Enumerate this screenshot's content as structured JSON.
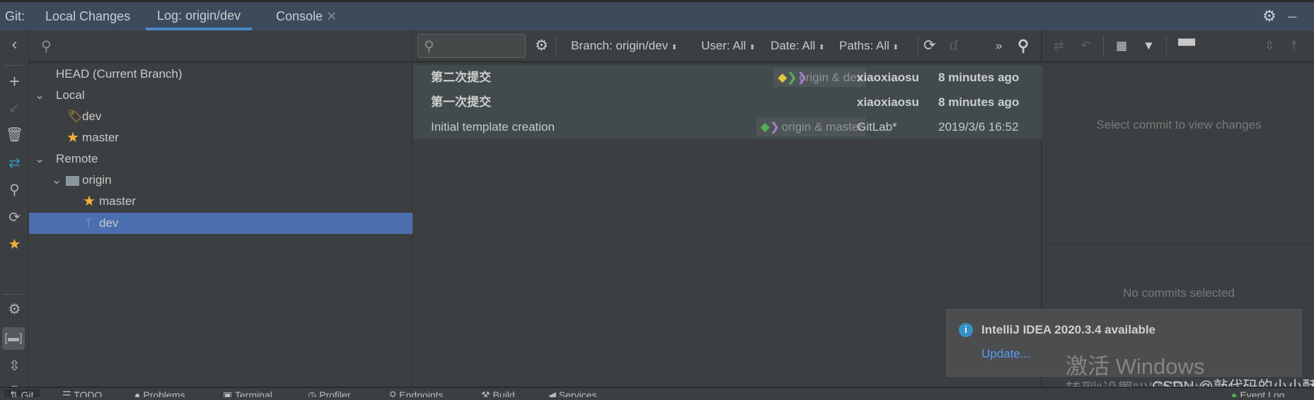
{
  "tabs": {
    "prefix": "Git:",
    "items": [
      {
        "label": "Local Changes"
      },
      {
        "label": "Log: origin/dev",
        "active": true
      },
      {
        "label": "Console",
        "closable": true
      }
    ],
    "settings_icon": "gear-icon"
  },
  "left_toolbar": [
    "chevron-left-icon",
    "plus-icon",
    "checkout-arrow-icon",
    "delete-icon",
    "merge-icon",
    "search-icon",
    "refresh-icon",
    "star-icon",
    "settings-icon",
    "group-folder-icon",
    "expand-all-icon",
    "collapse-all-icon"
  ],
  "tree": {
    "items": [
      {
        "label": "HEAD (Current Branch)",
        "level": 0
      },
      {
        "label": "Local",
        "level": 0,
        "expanded": true
      },
      {
        "label": "dev",
        "level": 1,
        "icon": "tag-icon"
      },
      {
        "label": "master",
        "level": 1,
        "icon": "star-icon"
      },
      {
        "label": "Remote",
        "level": 0,
        "expanded": true
      },
      {
        "label": "origin",
        "level": 1,
        "icon": "folder-icon",
        "expanded": true
      },
      {
        "label": "master",
        "level": 2,
        "icon": "star-icon"
      },
      {
        "label": "dev",
        "level": 2,
        "icon": "branch-icon",
        "selected": true
      }
    ]
  },
  "log_toolbar": {
    "search_placeholder": "",
    "branch": "Branch: origin/dev",
    "user": "User: All",
    "date": "Date: All",
    "paths": "Paths: All",
    "more": "»"
  },
  "commits": [
    {
      "message": "第二次提交",
      "refs": "origin & dev",
      "author": "xiaoxiaosu",
      "date": "8 minutes ago",
      "bold": true
    },
    {
      "message": "第一次提交",
      "refs": "",
      "author": "xiaoxiaosu",
      "date": "8 minutes ago",
      "bold": true
    },
    {
      "message": "Initial template creation",
      "refs": "origin & master",
      "author": "GitLab*",
      "date": "2019/3/6 16:52",
      "bold": false
    }
  ],
  "details": {
    "changes_hint": "Select commit to view changes",
    "commit_hint": "No commits selected"
  },
  "notification": {
    "title": "IntelliJ IDEA 2020.3.4 available",
    "action": "Update..."
  },
  "watermark": {
    "line1": "激活 Windows",
    "line2": "转到“设置”以激活 Windows。",
    "credit": "CSDN @敲代码的小小酥"
  },
  "bottom_bar": [
    "Git",
    "TODO",
    "Problems",
    "Terminal",
    "Profiler",
    "Endpoints",
    "Build",
    "Services",
    "Event Log"
  ],
  "colors": {
    "accent": "#4a88c7",
    "selection": "#4b6eaf",
    "star": "#f4af3d",
    "graph": "#a09e74",
    "link": "#589df6",
    "info": "#3592c4"
  }
}
